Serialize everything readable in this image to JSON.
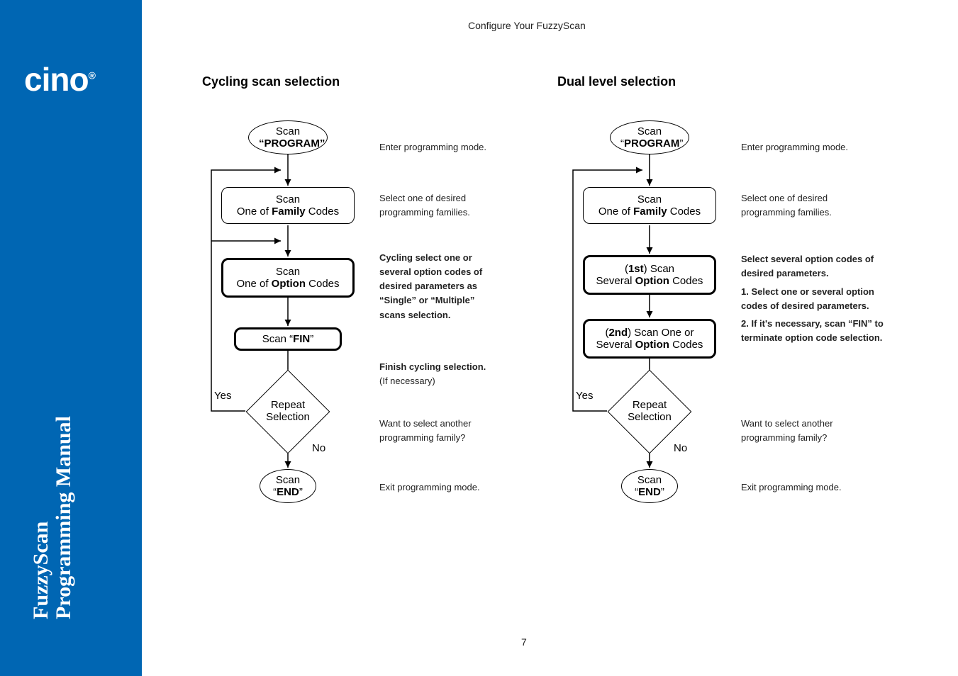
{
  "header": "Configure Your FuzzyScan",
  "page_number": "7",
  "brand": "cino",
  "side_title_line1": "FuzzyScan",
  "side_title_line2": "Programming Manual",
  "left": {
    "title": "Cycling scan selection",
    "n1_scan": "Scan",
    "n1_prog": "“PROGRAM”",
    "n2_scan": "Scan",
    "n2_sub_a": "One of ",
    "n2_sub_b": "Family",
    "n2_sub_c": " Codes",
    "n3_scan": "Scan",
    "n3_sub_a": "One of ",
    "n3_sub_b": "Option",
    "n3_sub_c": " Codes",
    "n4_a": "Scan “",
    "n4_b": "FIN",
    "n4_c": "”",
    "n5_a": "Repeat",
    "n5_b": "Selection",
    "n6_scan": "Scan",
    "n6_a": "“",
    "n6_b": "END",
    "n6_c": "”",
    "yes": "Yes",
    "no": "No",
    "note1": "Enter programming mode.",
    "note2a": "Select one of desired",
    "note2b": "programming families.",
    "note3a": "Cycling select one or",
    "note3b": "several option codes of",
    "note3c": "desired parameters as",
    "note3d": "“Single” or “Multiple”",
    "note3e": "scans selection.",
    "note4a": "Finish cycling selection.",
    "note4b": "(If necessary)",
    "note5a": "Want to select another",
    "note5b": "programming family?",
    "note6": "Exit programming mode."
  },
  "right": {
    "title": "Dual level selection",
    "n1_scan": "Scan",
    "n1_a": "“",
    "n1_b": "PROGRAM",
    "n1_c": "”",
    "n2_scan": "Scan",
    "n2_sub_a": "One of ",
    "n2_sub_b": "Family",
    "n2_sub_c": " Codes",
    "n3_a": "(",
    "n3_b": "1st",
    "n3_c": ") Scan",
    "n3_d_a": "Several ",
    "n3_d_b": "Option",
    "n3_d_c": " Codes",
    "n4_a": "(",
    "n4_b": "2nd",
    "n4_c": ") Scan One or",
    "n4_d_a": "Several ",
    "n4_d_b": "Option",
    "n4_d_c": " Codes",
    "n5_a": "Repeat",
    "n5_b": "Selection",
    "n6_scan": "Scan",
    "n6_a": "“",
    "n6_b": "END",
    "n6_c": "”",
    "yes": "Yes",
    "no": "No",
    "note1": "Enter programming mode.",
    "note2a": "Select one of desired",
    "note2b": "programming families.",
    "note3h": "Select several option codes of desired parameters.",
    "note3_1": "1. Select one or several option codes of desired parameters.",
    "note3_2": "2. If it's necessary, scan “FIN” to terminate option code selection.",
    "note5a": "Want to select another",
    "note5b": "programming family?",
    "note6": "Exit programming mode."
  }
}
